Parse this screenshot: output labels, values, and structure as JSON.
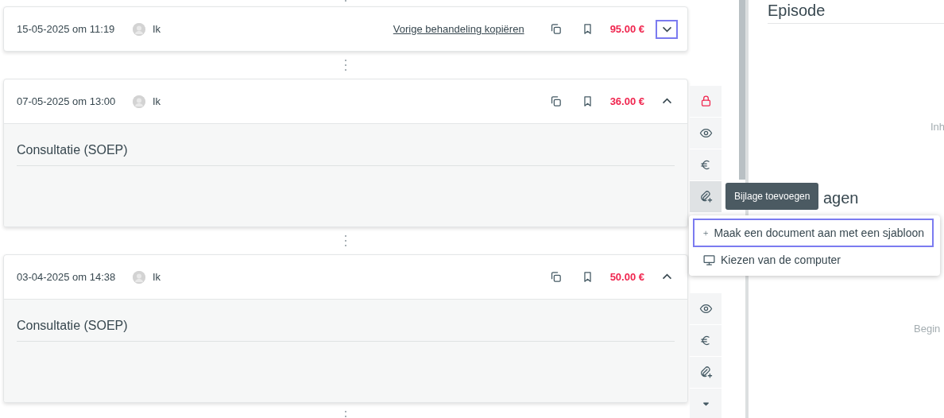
{
  "entries": [
    {
      "datetime": "15-05-2025 om 11:19",
      "author": "Ik",
      "copy_link": "Vorige behandeling kopiëren",
      "amount": "95.00 €",
      "expanded": false,
      "toggle_focused": true
    },
    {
      "datetime": "07-05-2025 om 13:00",
      "author": "Ik",
      "amount": "36.00 €",
      "expanded": true,
      "toggle_focused": false,
      "section_title": "Consultatie (SOEP)",
      "toolbar": [
        {
          "kind": "lock",
          "selected": false
        },
        {
          "kind": "eye",
          "selected": false
        },
        {
          "kind": "euro",
          "selected": false
        },
        {
          "kind": "attach",
          "selected": true
        }
      ]
    },
    {
      "datetime": "03-04-2025 om 14:38",
      "author": "Ik",
      "amount": "50.00 €",
      "expanded": true,
      "toggle_focused": false,
      "section_title": "Consultatie (SOEP)",
      "toolbar": [
        {
          "kind": "eye",
          "selected": false
        },
        {
          "kind": "euro",
          "selected": false
        },
        {
          "kind": "attach",
          "selected": false
        },
        {
          "kind": "more",
          "selected": false
        }
      ]
    }
  ],
  "side_panel": {
    "episode_title": "Episode",
    "contents_hint": "Inh",
    "attachments_title": "agen",
    "attachments_hint": "Begin"
  },
  "tooltip": "Bijlage toevoegen",
  "menu": [
    {
      "kind": "plus",
      "label": "Maak een document aan met een sjabloon",
      "focused": true
    },
    {
      "kind": "monitor",
      "label": "Kiezen van de computer",
      "focused": false
    }
  ]
}
